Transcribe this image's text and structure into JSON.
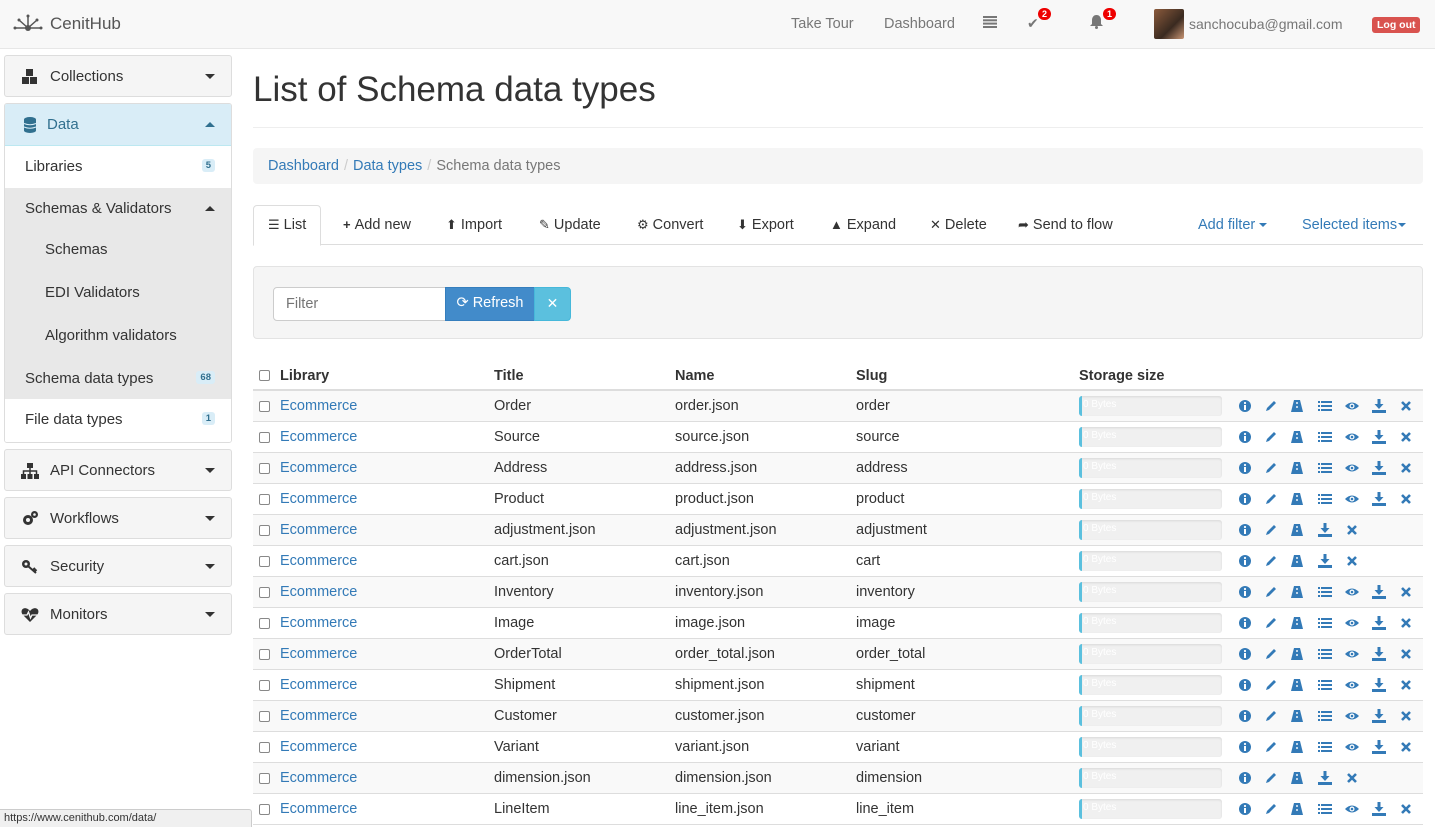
{
  "brand": {
    "name": "CenitHub"
  },
  "topnav": {
    "take_tour": "Take Tour",
    "dashboard": "Dashboard",
    "tasks_count": "2",
    "notifications_count": "1",
    "user_email": "sanchocuba@gmail.com",
    "logout": "Log out"
  },
  "sidebar": {
    "collections": "Collections",
    "data": "Data",
    "libraries": "Libraries",
    "libraries_count": "5",
    "schemas_validators": "Schemas & Validators",
    "schemas": "Schemas",
    "edi_validators": "EDI Validators",
    "algorithm_validators": "Algorithm validators",
    "schema_data_types": "Schema data types",
    "schema_data_types_count": "68",
    "file_data_types": "File data types",
    "file_data_types_count": "1",
    "api_connectors": "API Connectors",
    "workflows": "Workflows",
    "security": "Security",
    "monitors": "Monitors"
  },
  "page": {
    "title": "List of Schema data types"
  },
  "breadcrumb": {
    "dashboard": "Dashboard",
    "data_types": "Data types",
    "current": "Schema data types"
  },
  "tabs": {
    "list": "List",
    "add_new": "Add new",
    "import": "Import",
    "update": "Update",
    "convert": "Convert",
    "export": "Export",
    "expand": "Expand",
    "delete": "Delete",
    "send_to_flow": "Send to flow",
    "add_filter": "Add filter",
    "selected_items": "Selected items"
  },
  "filter": {
    "placeholder": "Filter",
    "refresh": "Refresh"
  },
  "table": {
    "headers": {
      "library": "Library",
      "title": "Title",
      "name": "Name",
      "slug": "Slug",
      "storage": "Storage size"
    },
    "storage_text": "0 Bytes",
    "rows": [
      {
        "library": "Ecommerce",
        "title": "Order",
        "name": "order.json",
        "slug": "order",
        "full": true
      },
      {
        "library": "Ecommerce",
        "title": "Source",
        "name": "source.json",
        "slug": "source",
        "full": true
      },
      {
        "library": "Ecommerce",
        "title": "Address",
        "name": "address.json",
        "slug": "address",
        "full": true
      },
      {
        "library": "Ecommerce",
        "title": "Product",
        "name": "product.json",
        "slug": "product",
        "full": true
      },
      {
        "library": "Ecommerce",
        "title": "adjustment.json",
        "name": "adjustment.json",
        "slug": "adjustment",
        "full": false
      },
      {
        "library": "Ecommerce",
        "title": "cart.json",
        "name": "cart.json",
        "slug": "cart",
        "full": false
      },
      {
        "library": "Ecommerce",
        "title": "Inventory",
        "name": "inventory.json",
        "slug": "inventory",
        "full": true
      },
      {
        "library": "Ecommerce",
        "title": "Image",
        "name": "image.json",
        "slug": "image",
        "full": true
      },
      {
        "library": "Ecommerce",
        "title": "OrderTotal",
        "name": "order_total.json",
        "slug": "order_total",
        "full": true
      },
      {
        "library": "Ecommerce",
        "title": "Shipment",
        "name": "shipment.json",
        "slug": "shipment",
        "full": true
      },
      {
        "library": "Ecommerce",
        "title": "Customer",
        "name": "customer.json",
        "slug": "customer",
        "full": true
      },
      {
        "library": "Ecommerce",
        "title": "Variant",
        "name": "variant.json",
        "slug": "variant",
        "full": true
      },
      {
        "library": "Ecommerce",
        "title": "dimension.json",
        "name": "dimension.json",
        "slug": "dimension",
        "full": false
      },
      {
        "library": "Ecommerce",
        "title": "LineItem",
        "name": "line_item.json",
        "slug": "line_item",
        "full": true
      }
    ]
  },
  "statusbar": {
    "url": "https://www.cenithub.com/data/"
  }
}
